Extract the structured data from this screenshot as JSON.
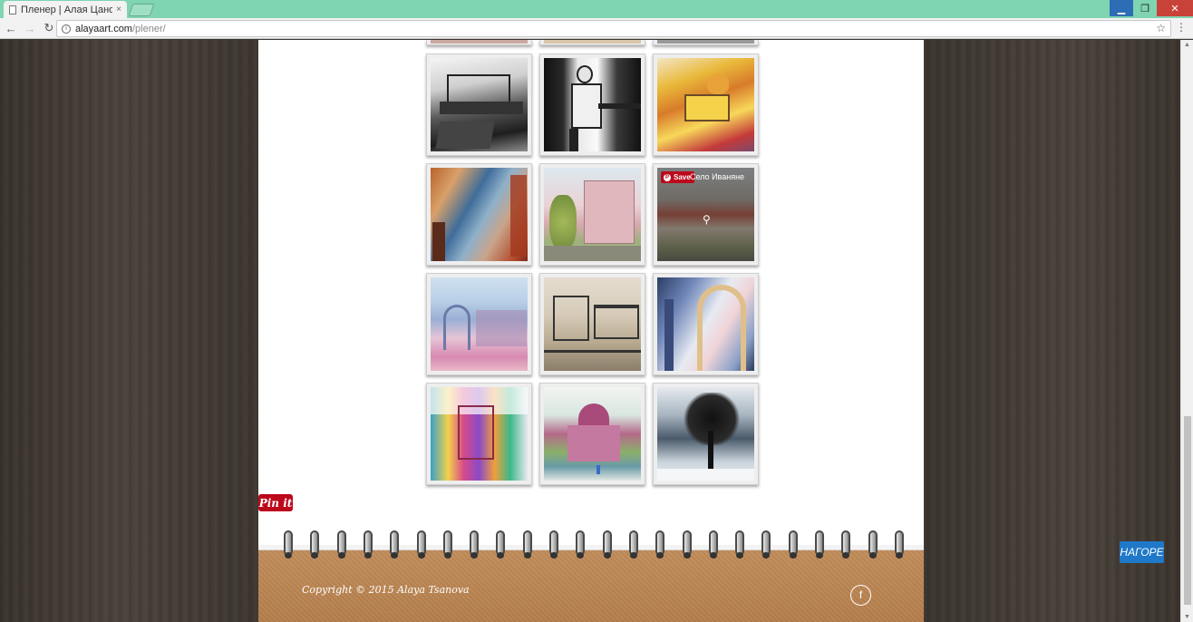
{
  "browser": {
    "tab_title": "Пленер | Алая Цанова",
    "tab_close": "×",
    "url_host": "alayaart.com",
    "url_path": "/plener/",
    "back_icon": "arrow-left-icon",
    "forward_icon": "arrow-right-icon",
    "reload_icon": "reload-icon",
    "minimize": "▁",
    "maximize": "❐",
    "close": "✕"
  },
  "gallery": {
    "hover_caption": "Село Иваняне",
    "save_label": "Save",
    "pin_it_label": "Pin it",
    "items": [
      {
        "name": "monastery-ink"
      },
      {
        "name": "man-at-table-ink"
      },
      {
        "name": "yellow-house"
      },
      {
        "name": "abstract-interior"
      },
      {
        "name": "pink-building"
      },
      {
        "name": "village-ivanyane"
      },
      {
        "name": "colorful-ruins"
      },
      {
        "name": "street-sketch"
      },
      {
        "name": "blue-arches"
      },
      {
        "name": "colorful-buildings"
      },
      {
        "name": "church-dome"
      },
      {
        "name": "winter-tree"
      }
    ]
  },
  "footer": {
    "copyright": "Copyright © 2015 Alaya Tsanova",
    "facebook": "f",
    "back_to_top": "НАГОРЕ"
  },
  "colors": {
    "chrome_green": "#7fd4b1",
    "pinterest_red": "#bd081c",
    "top_button_blue": "#1f78c8",
    "cork": "#c38e5c"
  }
}
